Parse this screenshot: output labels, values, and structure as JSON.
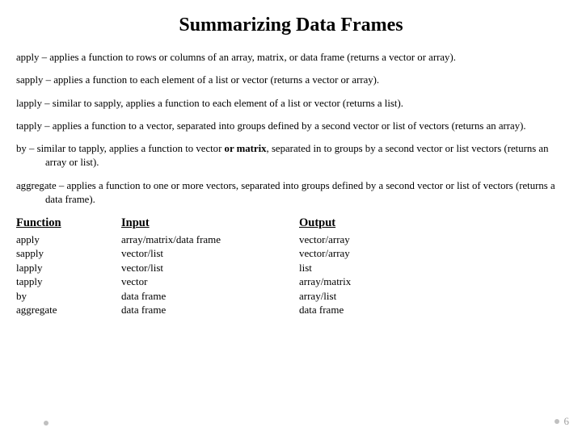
{
  "title": "Summarizing Data Frames",
  "defs": {
    "apply": "apply – applies a function to rows or columns of an array,  matrix, or data frame (returns a vector or array).",
    "sapply": "sapply – applies a function to each element of a list or vector (returns a vector or array).",
    "lapply": "lapply – similar to sapply, applies a function to each element of a list or vector (returns a list).",
    "tapply": "tapply – applies a function to a vector, separated into groups defined by a second vector or list of vectors (returns an array).",
    "by_pre": "by – similar to tapply, applies a function to vector ",
    "by_bold": "or matrix",
    "by_post": ", separated in to groups by a second vector or list vectors (returns an array or list).",
    "aggregate": "aggregate – applies a function to one or more vectors, separated into groups defined by a second vector or list of vectors (returns a data frame)."
  },
  "table": {
    "headers": {
      "func": "Function",
      "input": "Input",
      "output": "Output"
    },
    "rows": [
      {
        "func": "apply",
        "input": "array/matrix/data frame",
        "output": "vector/array"
      },
      {
        "func": "sapply",
        "input": "vector/list",
        "output": "vector/array"
      },
      {
        "func": "lapply",
        "input": "vector/list",
        "output": "list"
      },
      {
        "func": "tapply",
        "input": "vector",
        "output": "array/matrix"
      },
      {
        "func": "by",
        "input": "data frame",
        "output": "array/list"
      },
      {
        "func": "aggregate",
        "input": "data frame",
        "output": "data frame"
      }
    ]
  },
  "page_number": "6"
}
